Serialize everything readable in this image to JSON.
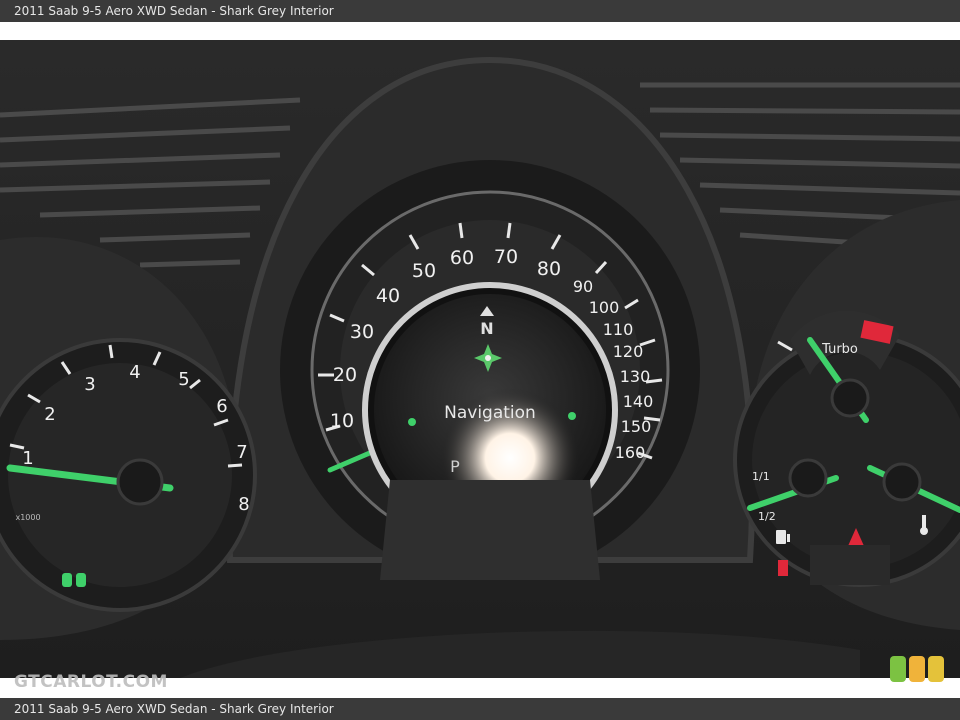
{
  "caption": {
    "top": "2011 Saab 9-5 Aero XWD Sedan - Shark Grey Interior",
    "bottom": "2011 Saab 9-5 Aero XWD Sedan - Shark Grey Interior"
  },
  "watermark": "GTCARLOT.COM",
  "speedometer": {
    "ticks": [
      "10",
      "20",
      "30",
      "40",
      "50",
      "60",
      "70",
      "80",
      "90",
      "100",
      "110",
      "120",
      "130",
      "140",
      "150",
      "160"
    ],
    "display_text": "Navigation",
    "compass_label": "N",
    "gear": "P"
  },
  "tachometer": {
    "ticks": [
      "1",
      "2",
      "3",
      "4",
      "5",
      "6",
      "7",
      "8"
    ],
    "unit": "x1000"
  },
  "right_gauge": {
    "turbo_label": "Turbo",
    "fuel_labels": [
      "1/1",
      "1/2"
    ]
  },
  "colors": {
    "needle": "#3fd06a",
    "redline": "#e0283a",
    "chrome": "#d8d8d8",
    "bar_bg": "#3a3a3a"
  }
}
